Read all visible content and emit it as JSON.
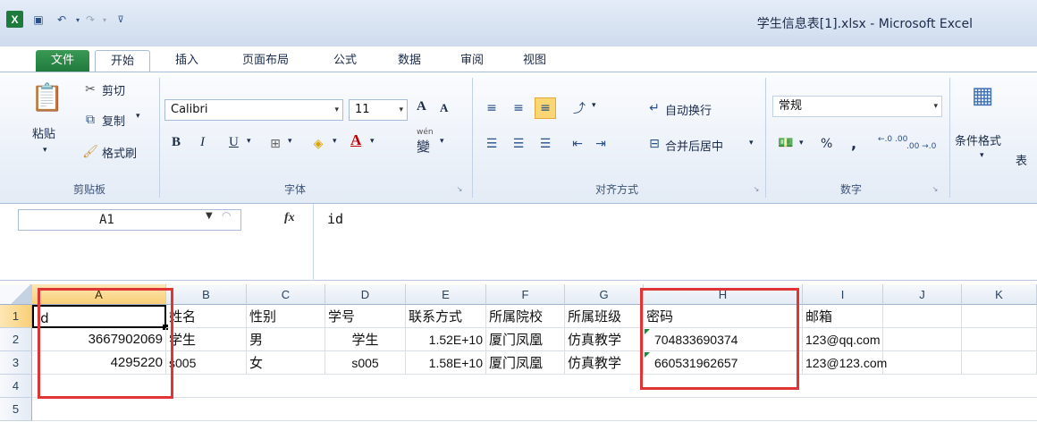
{
  "window": {
    "title": "学生信息表[1].xlsx - Microsoft Excel"
  },
  "tabs": [
    "文件",
    "开始",
    "插入",
    "页面布局",
    "公式",
    "数据",
    "审阅",
    "视图"
  ],
  "clipboard": {
    "paste": "粘贴",
    "cut": "剪切",
    "copy": "复制",
    "format_painter": "格式刷",
    "label": "剪贴板"
  },
  "font": {
    "name": "Calibri",
    "size": "11",
    "bold": "B",
    "italic": "I",
    "underline": "U",
    "label": "字体",
    "grow": "A",
    "shrink": "A",
    "wen": "wén",
    "wen_char": "變"
  },
  "alignment": {
    "wrap": "自动换行",
    "merge": "合并后居中",
    "label": "对齐方式"
  },
  "number": {
    "format": "常规",
    "percent": "%",
    "comma": ",",
    "inc": "←.0 .00",
    "dec": ".00 →.0",
    "label": "数字"
  },
  "styles": {
    "cond": "条件格式",
    "table": "表"
  },
  "formula_bar": {
    "cell_ref": "A1",
    "fx": "fx",
    "value": "id"
  },
  "columns": [
    "A",
    "B",
    "C",
    "D",
    "E",
    "F",
    "G",
    "H",
    "I",
    "J",
    "K"
  ],
  "rows": [
    "1",
    "2",
    "3",
    "4",
    "5"
  ],
  "cells": {
    "r1": [
      "id",
      "姓名",
      "性别",
      "学号",
      "联系方式",
      "所属院校",
      "所属班级",
      "密码",
      "邮箱"
    ],
    "r2": [
      "3667902069",
      "学生",
      "男",
      "学生",
      "1.52E+10",
      "厦门凤凰",
      "仿真教学",
      "704833690374",
      "123@qq.com"
    ],
    "r3": [
      "4295220",
      "s005",
      "女",
      "s005",
      "1.58E+10",
      "厦门凤凰",
      "仿真教学",
      "660531962657",
      "123@123.com"
    ]
  },
  "colors": {
    "accent": "#1f7a3d",
    "highlight": "#e03535",
    "selection": "#000000"
  }
}
